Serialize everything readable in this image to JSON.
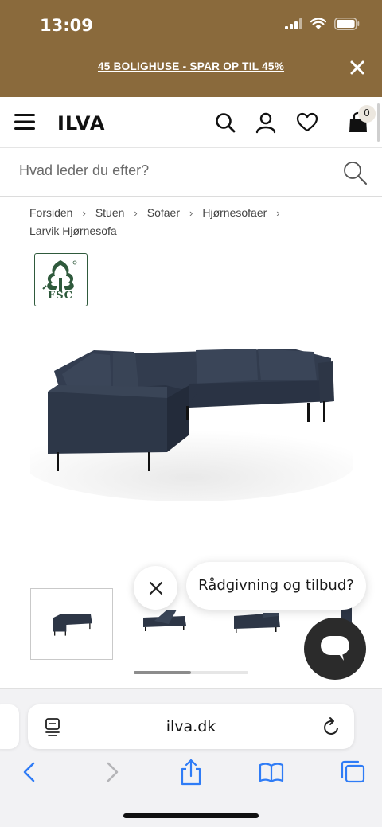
{
  "status_bar": {
    "time": "13:09"
  },
  "promo": {
    "text": "45 BOLIGHUSE - SPAR OP TIL 45%"
  },
  "header": {
    "logo": "ILVA",
    "cart_count": "0"
  },
  "search": {
    "placeholder": "Hvad leder du efter?"
  },
  "breadcrumb": {
    "items": [
      "Forsiden",
      "Stuen",
      "Sofaer",
      "Hjørnesofaer",
      "Larvik Hjørnesofa"
    ],
    "separator": "›"
  },
  "badge": {
    "label": "FSC"
  },
  "chat": {
    "bubble_text": "Rådgivning og tilbud?"
  },
  "browser": {
    "url": "ilva.dk"
  },
  "colors": {
    "brand_band": "#8a6a3c",
    "sofa": "#2d3646",
    "chat_launcher": "#2b2b2b"
  },
  "icons": [
    "signal-icon",
    "wifi-icon",
    "battery-icon",
    "close-icon",
    "menu-icon",
    "search-icon",
    "user-icon",
    "heart-icon",
    "bag-icon",
    "fsc-tree-icon",
    "reader-icon",
    "reload-icon",
    "back-icon",
    "forward-icon",
    "share-icon",
    "bookmarks-icon",
    "tabs-icon"
  ]
}
